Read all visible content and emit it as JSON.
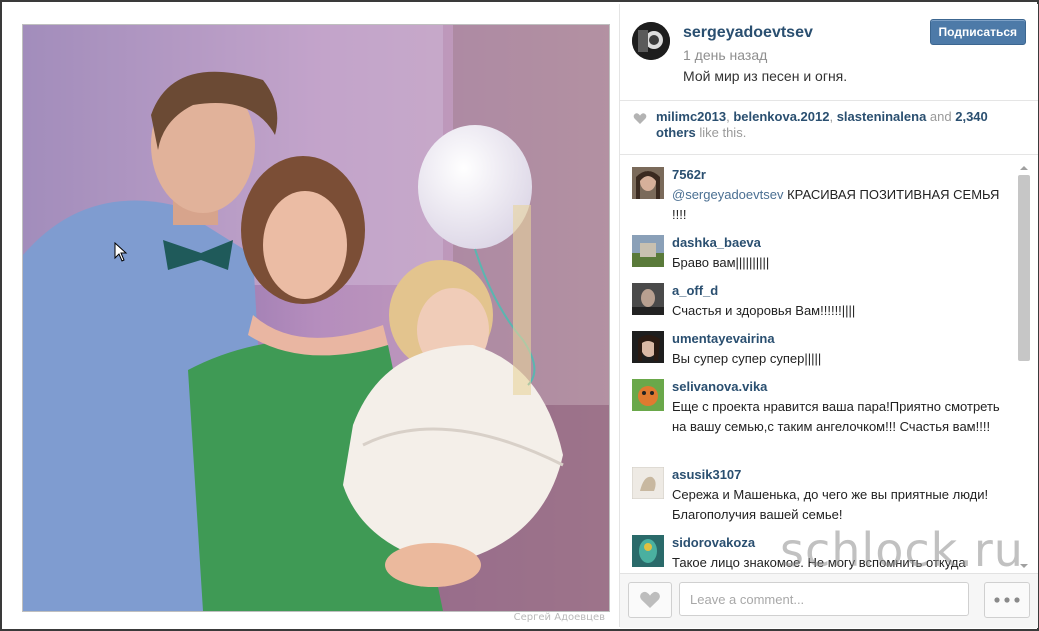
{
  "post": {
    "username": "sergeyadoevtsev",
    "time": "1 день назад",
    "caption": "Мой мир из песен и огня.",
    "follow_label": "Подписаться",
    "photo_credit": "Сергей Адоевцев"
  },
  "likes": {
    "user1": "milimc2013",
    "sep1": ", ",
    "user2": "belenkova.2012",
    "sep2": ", ",
    "user3": "slasteninalena",
    "and": " and ",
    "others": "2,340 others",
    "suffix": " like this."
  },
  "comments": [
    {
      "user": "7562r",
      "mention": "@sergeyadoevtsev",
      "text": " КРАСИВАЯ ПОЗИТИВНАЯ СЕМЬЯ !!!!"
    },
    {
      "user": "dashka_baeva",
      "text": "Браво вам||||||||||"
    },
    {
      "user": "a_off_d",
      "text": "Счастья и здоровья Вам!!!!!!||||"
    },
    {
      "user": "umentayevairina",
      "text": "Вы супер супер супер|||||"
    },
    {
      "user": "selivanova.vika",
      "text": "Еще с проекта нравится ваша пара!Приятно смотреть на вашу семью,с таким ангелочком!!! Счастья вам!!!!"
    },
    {
      "user": "asusik3107",
      "text": "Сережа и Машенька, до чего же вы приятные люди! Благополучия вашей семье!"
    },
    {
      "user": "sidorovakoza",
      "text": "Такое лицо знакомое. Не могу вспомнить откуда"
    }
  ],
  "footer": {
    "comment_placeholder": "Leave a comment..."
  },
  "watermark": "schlock.ru",
  "colors": {
    "username_link": "#2a4f70",
    "follow_button": "#4d7aa8",
    "frame_border": "#3a3a3a"
  },
  "icons": {
    "like": "heart-icon",
    "more": "ellipsis-icon",
    "cursor": "mouse-pointer-icon"
  }
}
